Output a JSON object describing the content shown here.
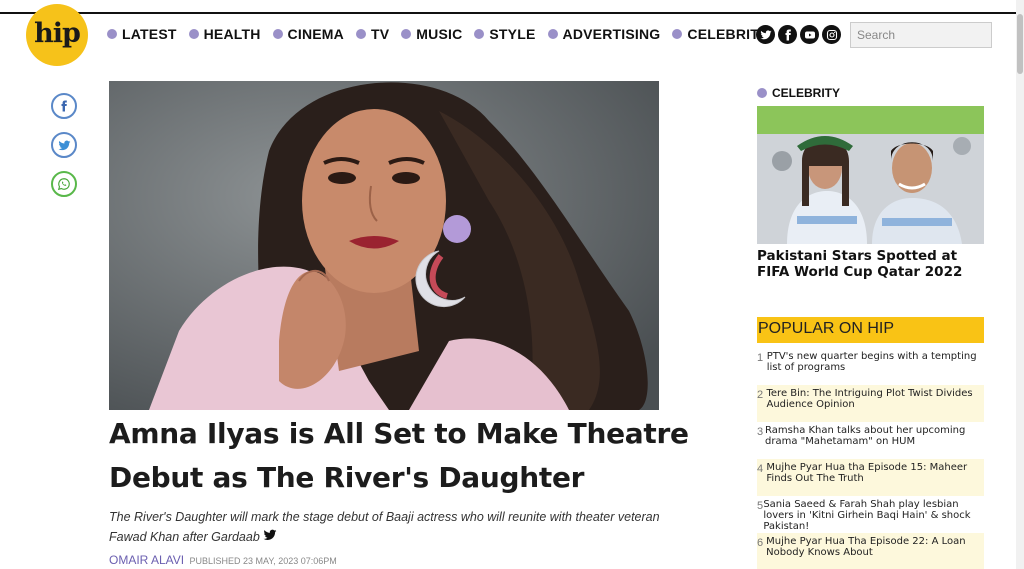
{
  "brand": {
    "logo_text": "hip",
    "logo_color": "#f6c21a"
  },
  "nav": {
    "dot_color": "#9a90c8",
    "items": [
      "LATEST",
      "HEALTH",
      "CINEMA",
      "TV",
      "MUSIC",
      "STYLE",
      "ADVERTISING",
      "CELEBRITY"
    ]
  },
  "header": {
    "socials": [
      "twitter-icon",
      "facebook-icon",
      "youtube-icon",
      "instagram-icon"
    ],
    "search_placeholder": "Search"
  },
  "share": [
    "facebook-share-icon",
    "twitter-share-icon",
    "whatsapp-share-icon"
  ],
  "article": {
    "headline": "Amna Ilyas is All Set to Make Theatre Debut as The River's Daughter",
    "standfirst": "The River's Daughter will mark the stage debut of Baaji actress who will reunite with theater veteran Fawad Khan after Gardaab",
    "author": "OMAIR ALAVI",
    "published": "PUBLISHED 23 MAY, 2023 07:06PM"
  },
  "sidebar": {
    "category": "CELEBRITY",
    "featured_title": "Pakistani Stars Spotted at FIFA World Cup Qatar 2022",
    "popular_heading": "POPULAR ON HIP",
    "popular": [
      {
        "num": "1",
        "text": "PTV's new quarter begins with a tempting list of programs"
      },
      {
        "num": "2",
        "text": "Tere Bin: The Intriguing Plot Twist Divides Audience Opinion"
      },
      {
        "num": "3",
        "text": "Ramsha Khan talks about her upcoming drama \"Mahetamam\" on HUM"
      },
      {
        "num": "4",
        "text": "Mujhe Pyar Hua tha Episode 15: Maheer Finds Out The Truth"
      },
      {
        "num": "5",
        "text": "Sania Saeed & Farah Shah play lesbian lovers in 'Kitni Girhein Baqi Hain' & shock Pakistan!"
      },
      {
        "num": "6",
        "text": "Mujhe Pyar Hua Tha Episode 22: A Loan Nobody Knows About"
      }
    ]
  }
}
